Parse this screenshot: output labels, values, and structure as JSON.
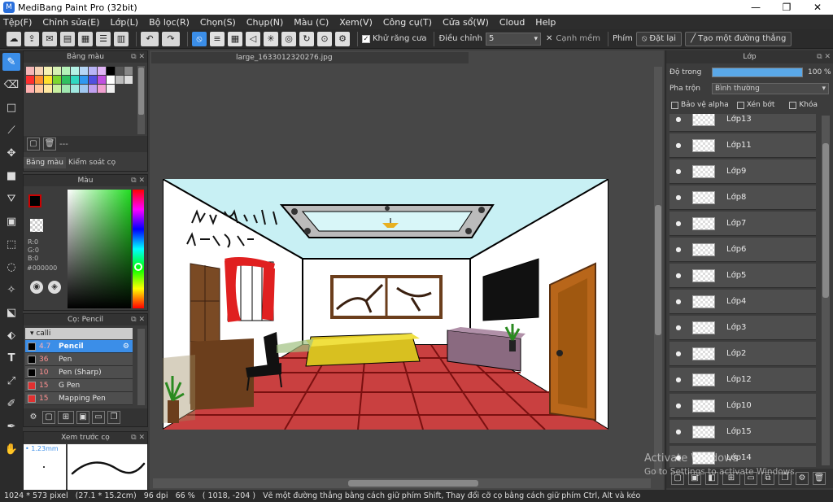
{
  "window": {
    "title": "MediBang Paint Pro (32bit)",
    "minimize": "—",
    "restore": "❐",
    "close": "✕"
  },
  "menu": [
    "Tệp(F)",
    "Chỉnh sửa(E)",
    "Lớp(L)",
    "Bộ lọc(R)",
    "Chọn(S)",
    "Chụp(N)",
    "Màu (C)",
    "Xem(V)",
    "Công cụ(T)",
    "Cửa sổ(W)",
    "Cloud",
    "Help"
  ],
  "toolbar": {
    "antialias_label": "Khử răng cưa",
    "adjust_label": "Điều chỉnh",
    "adjust_value": "5",
    "soft_edge_label": "Cạnh mềm",
    "key_label": "Phím",
    "reset_label": "Đặt lại",
    "line_label": "Tạo một đường thẳng"
  },
  "panels": {
    "palette_title": "Bảng màu",
    "palette_tab1": "Bảng màu",
    "palette_tab2": "Kiểm soát cọ",
    "palette_dash": "---",
    "color_title": "Màu",
    "color_r": "R:0",
    "color_g": "G:0",
    "color_b": "B:0",
    "color_hex": "#000000",
    "brush_title": "Cọ: Pencil",
    "brush_group": "calli",
    "brush_preview_title": "Xem trước cọ",
    "brush_preview_size": "1.23mm",
    "brushes": [
      {
        "size": "4.7",
        "name": "Pencil",
        "color": "#000000",
        "selected": true
      },
      {
        "size": "36",
        "name": "Pen",
        "color": "#000000",
        "selected": false
      },
      {
        "size": "10",
        "name": "Pen (Sharp)",
        "color": "#000000",
        "selected": false
      },
      {
        "size": "15",
        "name": "G Pen",
        "color": "#e03030",
        "selected": false
      },
      {
        "size": "15",
        "name": "Mapping Pen",
        "color": "#e03030",
        "selected": false
      }
    ]
  },
  "palette_colors": [
    "#f4b6b6",
    "#f6d2b4",
    "#f6f2b4",
    "#d6f2b4",
    "#b4f2b8",
    "#b4f2e6",
    "#b4d6f6",
    "#b8b4f6",
    "#e0b4f6",
    "#000000",
    "#555555",
    "#888888",
    "#ff3030",
    "#ff9030",
    "#ffe030",
    "#7cd830",
    "#30c060",
    "#30d8c0",
    "#3098f0",
    "#5050e0",
    "#c050e0",
    "#ffffff",
    "#bbbbbb",
    "#dddddd",
    "#ffb0b0",
    "#ffc8a0",
    "#ffe8a0",
    "#c8f0a0",
    "#a0e8b0",
    "#a0e8e0",
    "#a0c8f0",
    "#c0a0f0",
    "#f0a0d0",
    "#f0f0f0"
  ],
  "document": {
    "tab": "large_1633012320276.jpg"
  },
  "layers": {
    "title": "Lớp",
    "opacity_label": "Độ trong",
    "opacity_value": "100 %",
    "blend_label": "Pha trộn",
    "blend_value": "Bình thường",
    "protect_alpha": "Bảo vệ alpha",
    "clipping": "Xén bớt",
    "lock": "Khóa",
    "items": [
      "Lớp13",
      "Lớp11",
      "Lớp9",
      "Lớp8",
      "Lớp7",
      "Lớp6",
      "Lớp5",
      "Lớp4",
      "Lớp3",
      "Lớp2",
      "Lớp12",
      "Lớp10",
      "Lớp15",
      "Lớp14"
    ]
  },
  "status": {
    "size": "1024 * 573 pixel",
    "physical": "(27.1 * 15.2cm)",
    "dpi": "96 dpi",
    "zoom": "66 %",
    "coords": "( 1018, -204 )",
    "hint": "Vẽ một đường thẳng bằng cách giữ phím Shift, Thay đổi cỡ cọ bằng cách giữ phím Ctrl, Alt và kéo"
  },
  "watermark": {
    "line1": "Activate Windows",
    "line2": "Go to Settings to activate Windows."
  },
  "colors": {
    "accent": "#3b8ee8",
    "panel": "#3c3c3c",
    "toolbar": "#2b2b2b"
  }
}
